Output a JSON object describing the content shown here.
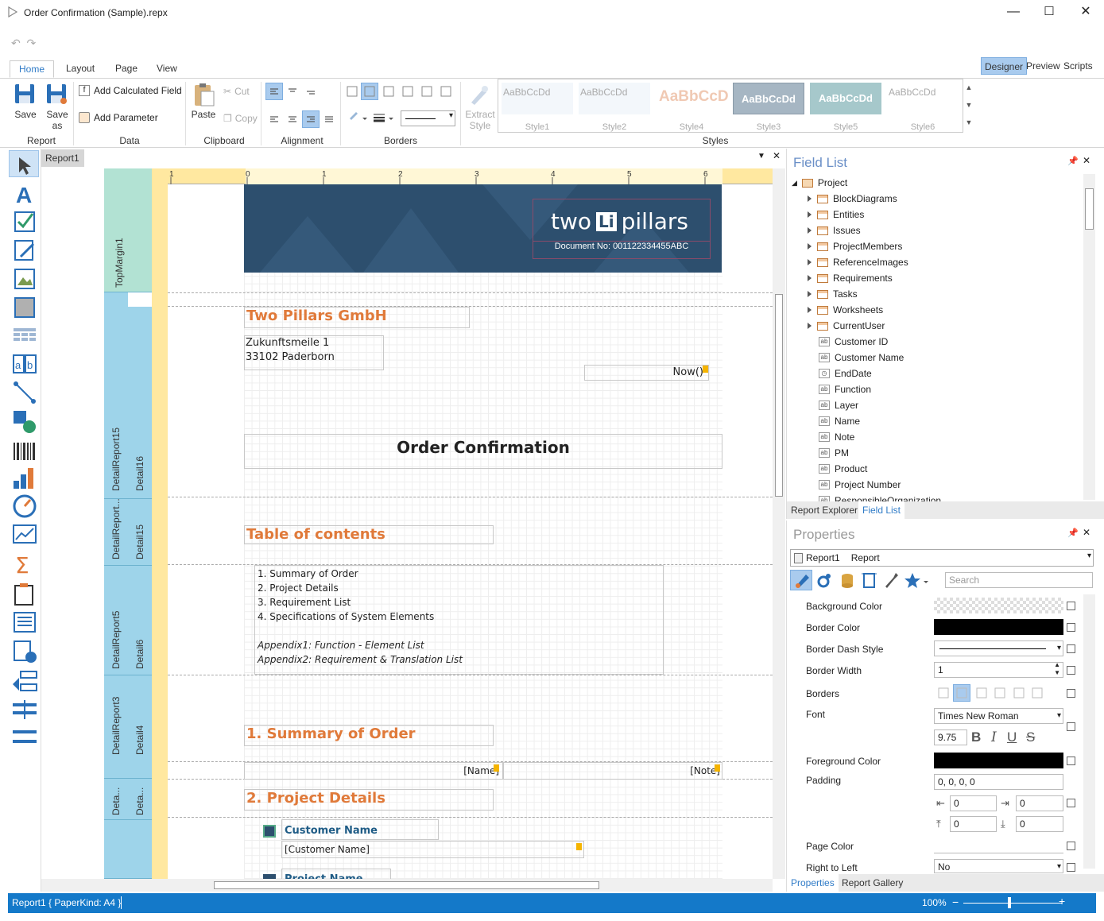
{
  "window": {
    "title": "Order Confirmation (Sample).repx",
    "minimize": "—",
    "maximize": "☐",
    "close": "✕"
  },
  "ribbon": {
    "tabs": [
      "Home",
      "Layout",
      "Page",
      "View"
    ],
    "modes": [
      "Designer",
      "Preview",
      "Scripts"
    ],
    "groups": {
      "report": "Report",
      "data": "Data",
      "clipboard": "Clipboard",
      "alignment": "Alignment",
      "borders": "Borders",
      "styles": "Styles"
    },
    "save": "Save",
    "save_as_1": "Save",
    "save_as_2": "as",
    "add_calculated_field": "Add Calculated Field",
    "add_parameter": "Add Parameter",
    "paste": "Paste",
    "cut": "Cut",
    "copy": "Copy",
    "extract_1": "Extract",
    "extract_2": "Style",
    "styles": [
      {
        "sample": "AaBbCcDd",
        "name": "Style1"
      },
      {
        "sample": "AaBbCcDd",
        "name": "Style2"
      },
      {
        "sample": "AaBbCcD",
        "name": "Style4"
      },
      {
        "sample": "AaBbCcDd",
        "name": "Style3"
      },
      {
        "sample": "AaBbCcDd",
        "name": "Style5"
      },
      {
        "sample": "AaBbCcDd",
        "name": "Style6"
      }
    ]
  },
  "document": {
    "tab": "Report1"
  },
  "bands": {
    "top_margin": "TopMargin1",
    "dr15": "DetailReport15",
    "d16": "Detail16",
    "dr_trunc": "DetailReport...",
    "d15": "Detail15",
    "dr5": "DetailReport5",
    "d6": "Detail6",
    "dr3": "DetailReport3",
    "d4": "Detail4",
    "deta1": "Deta...",
    "deta2": "Deta..."
  },
  "ruler": {
    "marks": [
      "1",
      "0",
      "1",
      "2",
      "3",
      "4",
      "5",
      "6"
    ]
  },
  "report": {
    "logo_left": "two",
    "logo_mark": "Li",
    "logo_right": "pillars",
    "doc_no": "Document No: 001122334455ABC",
    "company": "Two Pillars GmbH",
    "address1": "Zukunftsmeile 1",
    "address2": "33102 Paderborn",
    "now": "Now()",
    "heading": "Order Confirmation",
    "toc_title": "Table of contents",
    "toc": [
      "1. Summary of Order",
      "2. Project Details",
      "3. Requirement List",
      "4. Specifications of System Elements"
    ],
    "appendix1": "Appendix1: Function - Element List",
    "appendix2": "Appendix2: Requirement & Translation List",
    "sec1": "1. Summary of Order",
    "name_field": "[Name]",
    "note_field": "[Note]",
    "sec2": "2. Project Details",
    "cust_name_label": "Customer Name",
    "cust_name_field": "[Customer Name]",
    "proj_name_label": "Project Name"
  },
  "field_list": {
    "title": "Field List",
    "root": "Project",
    "tables": [
      "BlockDiagrams",
      "Entities",
      "Issues",
      "ProjectMembers",
      "ReferenceImages",
      "Requirements",
      "Tasks",
      "Worksheets",
      "CurrentUser"
    ],
    "fields": [
      {
        "name": "Customer ID",
        "icon": "ab"
      },
      {
        "name": "Customer Name",
        "icon": "ab"
      },
      {
        "name": "EndDate",
        "icon": "clock"
      },
      {
        "name": "Function",
        "icon": "ab"
      },
      {
        "name": "Layer",
        "icon": "ab"
      },
      {
        "name": "Name",
        "icon": "ab"
      },
      {
        "name": "Note",
        "icon": "ab"
      },
      {
        "name": "PM",
        "icon": "ab"
      },
      {
        "name": "Product",
        "icon": "ab"
      },
      {
        "name": "Project Number",
        "icon": "ab"
      },
      {
        "name": "ResponsibleOrganization",
        "icon": "ab"
      }
    ],
    "tabs": [
      "Report Explorer",
      "Field List"
    ]
  },
  "properties": {
    "title": "Properties",
    "object_name": "Report1",
    "object_type": "Report",
    "search_placeholder": "Search",
    "rows": {
      "background_color": "Background Color",
      "border_color": "Border Color",
      "border_dash_style": "Border Dash Style",
      "border_width": "Border Width",
      "border_width_val": "1",
      "borders": "Borders",
      "font": "Font",
      "font_val": "Times New Roman",
      "font_size": "9.75",
      "foreground_color": "Foreground Color",
      "padding": "Padding",
      "padding_val": "0, 0, 0, 0",
      "pad_left": "0",
      "pad_right": "0",
      "pad_top": "0",
      "pad_bottom": "0",
      "page_color": "Page Color",
      "right_to_left": "Right to Left",
      "right_to_left_val": "No"
    },
    "tabs": [
      "Properties",
      "Report Gallery"
    ]
  },
  "status": {
    "left": "Report1 { PaperKind: A4 }",
    "zoom": "100%"
  },
  "colors": {
    "accent": "#1479c9",
    "orange": "#e07a3a",
    "band": "#9ed4ea",
    "ruler": "#ffe8a0",
    "header_blue": "#2d4f6e"
  }
}
